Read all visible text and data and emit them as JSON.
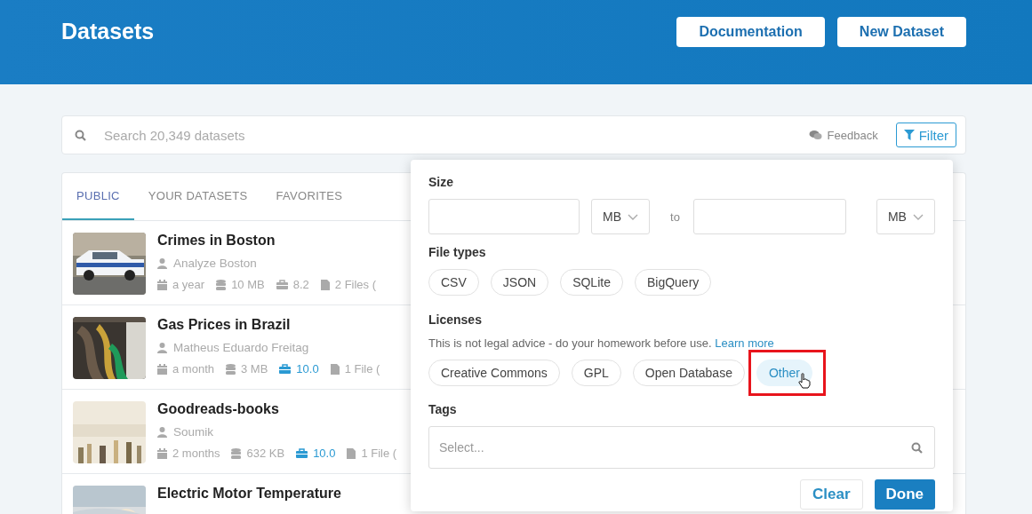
{
  "header": {
    "title": "Datasets",
    "buttons": [
      "Documentation",
      "New Dataset"
    ]
  },
  "search": {
    "placeholder": "Search 20,349 datasets",
    "feedback": "Feedback",
    "filter": "Filter"
  },
  "tabs": [
    {
      "label": "PUBLIC",
      "selected": true
    },
    {
      "label": "YOUR DATASETS",
      "selected": false
    },
    {
      "label": "FAVORITES",
      "selected": false
    }
  ],
  "datasets": [
    {
      "title": "Crimes in Boston",
      "author": "Analyze Boston",
      "age": "a year",
      "size": "10 MB",
      "usability": "8.2",
      "usability_high": false,
      "files": "2 Files ("
    },
    {
      "title": "Gas Prices in Brazil",
      "author": "Matheus Eduardo Freitag",
      "age": "a month",
      "size": "3 MB",
      "usability": "10.0",
      "usability_high": true,
      "files": "1 File ("
    },
    {
      "title": "Goodreads-books",
      "author": "Soumik",
      "age": "2 months",
      "size": "632 KB",
      "usability": "10.0",
      "usability_high": true,
      "files": "1 File ("
    },
    {
      "title": "Electric Motor Temperature"
    }
  ],
  "filter_panel": {
    "size": {
      "label": "Size",
      "min_unit": "MB",
      "separator": "to",
      "max_unit": "MB"
    },
    "file_types": {
      "label": "File types",
      "options": [
        {
          "label": "CSV",
          "selected": false
        },
        {
          "label": "JSON",
          "selected": false
        },
        {
          "label": "SQLite",
          "selected": false
        },
        {
          "label": "BigQuery",
          "selected": false
        }
      ]
    },
    "licenses": {
      "label": "Licenses",
      "note": "This is not legal advice - do your homework before use.",
      "link": "Learn more",
      "options": [
        {
          "label": "Creative Commons",
          "selected": false,
          "annotated": false
        },
        {
          "label": "GPL",
          "selected": false,
          "annotated": false
        },
        {
          "label": "Open Database",
          "selected": false,
          "annotated": false
        },
        {
          "label": "Other",
          "selected": true,
          "annotated": true
        }
      ]
    },
    "tags": {
      "label": "Tags",
      "placeholder": "Select..."
    },
    "buttons": [
      {
        "label": "Clear",
        "kind": "secondary"
      },
      {
        "label": "Done",
        "kind": "primary"
      }
    ]
  }
}
